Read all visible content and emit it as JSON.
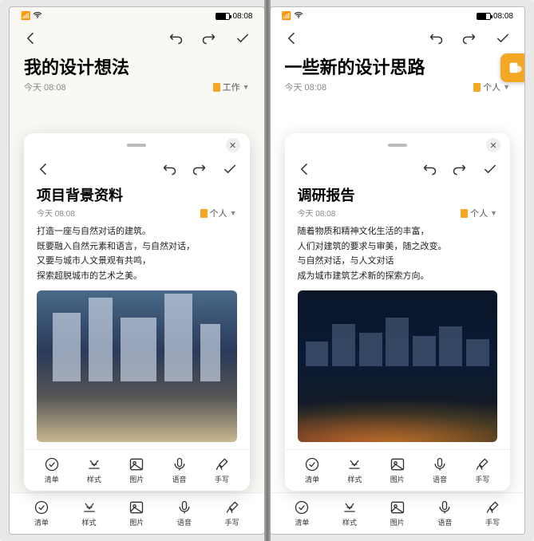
{
  "status": {
    "signal": "5G",
    "time_right": "08:08"
  },
  "left": {
    "title": "我的设计想法",
    "date": "今天 08:08",
    "tag": "工作",
    "card": {
      "title": "项目背景资料",
      "date": "今天 08:08",
      "tag": "个人",
      "body": [
        "打造一座与自然对话的建筑。",
        "既要融入自然元素和语言，与自然对话，",
        "又要与城市人文景观有共鸣，",
        "探索超脱城市的艺术之美。"
      ]
    }
  },
  "right": {
    "title": "一些新的设计思路",
    "date": "今天 08:08",
    "tag": "个人",
    "card": {
      "title": "调研报告",
      "date": "今天 08:08",
      "tag": "个人",
      "body": [
        "随着物质和精神文化生活的丰富，",
        "人们对建筑的要求与审美，随之改变。",
        "与自然对话，与人文对话",
        "成为城市建筑艺术新的探索方向。"
      ]
    }
  },
  "tools": {
    "list": "清单",
    "style": "样式",
    "image": "图片",
    "voice": "语音",
    "hand": "手写"
  }
}
